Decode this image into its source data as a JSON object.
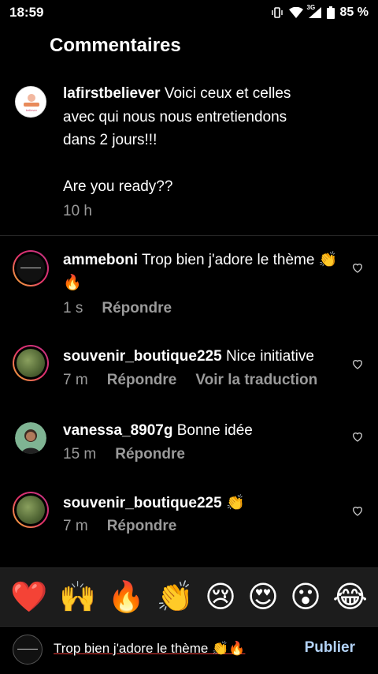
{
  "status_bar": {
    "time": "18:59",
    "network": "3G",
    "battery": "85 %"
  },
  "title": "Commentaires",
  "caption": {
    "username": "lafirstbeliever",
    "text_line1": "Voici ceux et celles avec qui nous nous entretiendons dans 2 jours!!!",
    "text_line2": "Are you ready??",
    "time": "10 h"
  },
  "comments": [
    {
      "username": "ammeboni",
      "text": "Trop bien j'adore le thème",
      "emojis": "👏🔥",
      "time": "1 s",
      "reply": "Répondre",
      "translate": ""
    },
    {
      "username": "souvenir_boutique225",
      "text": "Nice initiative",
      "emojis": "",
      "time": "7 m",
      "reply": "Répondre",
      "translate": "Voir la traduction"
    },
    {
      "username": "vanessa_8907g",
      "text": "Bonne idée",
      "emojis": "",
      "time": "15 m",
      "reply": "Répondre",
      "translate": ""
    },
    {
      "username": "souvenir_boutique225",
      "text": "",
      "emojis": "👏",
      "time": "7 m",
      "reply": "Répondre",
      "translate": ""
    }
  ],
  "emoji_bar": [
    "❤️",
    "🙌",
    "🔥",
    "👏",
    "😢",
    "😍",
    "😮",
    "😂"
  ],
  "composer": {
    "value": "Trop bien j'adore le thème 👏🔥",
    "publish": "Publier"
  },
  "colors": {
    "background": "#000000",
    "link": "#b3d3f7",
    "muted": "#9a9a9a"
  }
}
